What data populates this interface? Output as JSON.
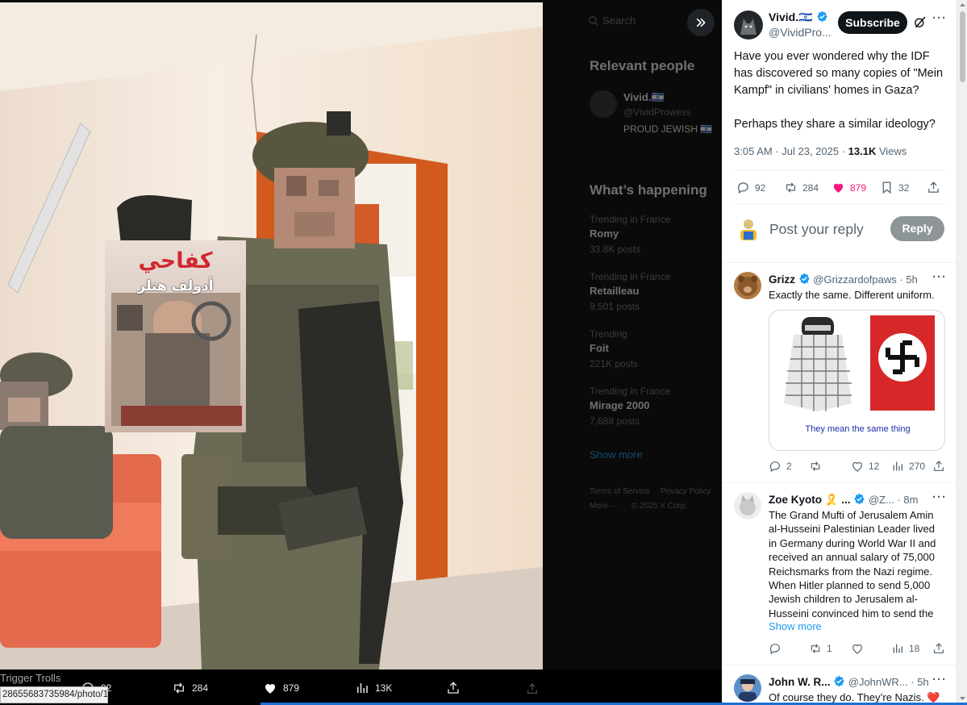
{
  "media": {
    "background": {
      "search_placeholder": "Search",
      "relevant_people_heading": "Relevant people",
      "person_name": "Vivid.🇮🇱",
      "person_handle": "@VividProwess",
      "person_bio": "PROUD JEWISH 🇮🇱",
      "happening_heading": "What’s happening",
      "trends": [
        {
          "context": "Trending in France",
          "name": "Romy",
          "posts": "33.8K posts"
        },
        {
          "context": "Trending in France",
          "name": "Retailleau",
          "posts": "9,501 posts"
        },
        {
          "context": "Trending",
          "name": "Foit",
          "posts": "221K posts"
        },
        {
          "context": "Trending in France",
          "name": "Mirage 2000",
          "posts": "7,688 posts"
        }
      ],
      "show_more": "Show more",
      "footer_links": [
        "Terms of Service",
        "Privacy Policy",
        "More ···",
        "© 2025 X Corp."
      ]
    },
    "photo": {
      "book_title": "كفاحي",
      "book_author": "أدولف هتلر"
    },
    "actions": {
      "replies": "92",
      "reposts": "284",
      "likes": "879",
      "views": "13K"
    },
    "overlay_link_text": "Trigger Trolls",
    "status_url": "28655683735984/photo/1"
  },
  "post": {
    "author_name": "Vivid.🇮🇱",
    "author_handle": "@VividPro...",
    "subscribe_label": "Subscribe",
    "text_p1": "Have you ever wondered why the IDF has discovered so many copies of \"Mein Kampf\" in civilians' homes in Gaza?",
    "text_p2": "Perhaps they share a similar ideology?",
    "time": "3:05 AM · Jul 23, 2025 ·",
    "views_count": "13.1K",
    "views_label": "Views",
    "stats": {
      "replies": "92",
      "reposts": "284",
      "likes": "879",
      "bookmarks": "32"
    }
  },
  "composer": {
    "placeholder": "Post your reply",
    "reply_button": "Reply"
  },
  "replies": [
    {
      "name": "Grizz",
      "handle": "@Grizzardofpaws",
      "time": "· 5h",
      "text": "Exactly the same. Different uniform.",
      "image_caption": "They mean the same thing",
      "stats": {
        "replies": "2",
        "reposts": "",
        "likes": "12",
        "views": "270"
      }
    },
    {
      "name": "Zoe Kyoto 🎗️ ...",
      "handle": "@Z...",
      "time": "· 8m",
      "text": "The Grand Mufti of Jerusalem Amin al-Husseini Palestinian Leader lived in Germany during World War II and received an annual salary of 75,000 Reichsmarks from the Nazi regime. When Hitler planned to send 5,000 Jewish children to Jerusalem al-Husseini convinced him to send the",
      "show_more": "Show more",
      "stats": {
        "replies": "",
        "reposts": "1",
        "likes": "",
        "views": "18"
      }
    },
    {
      "name": "John W. R...",
      "handle": "@JohnWR...",
      "time": "· 5h",
      "text": "Of course they do. They’re Nazis. ❤️"
    }
  ],
  "colors": {
    "accent": "#1d9bf0",
    "like": "#f91880",
    "dark": "#0f1419",
    "muted": "#536471",
    "flag_red": "#d62828"
  }
}
